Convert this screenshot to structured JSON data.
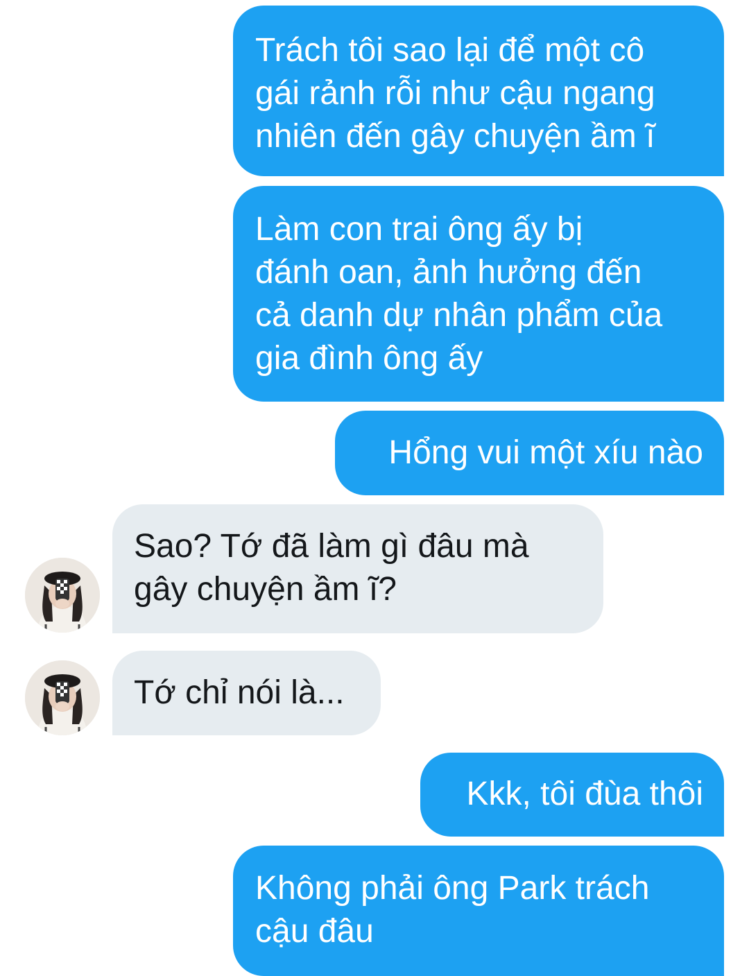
{
  "conversation": {
    "messages": [
      {
        "sender": "me",
        "text": "Trách tôi sao lại để một cô\ngái rảnh rỗi như cậu ngang\nnhiên đến gây chuyện ầm ĩ"
      },
      {
        "sender": "me",
        "text": "Làm con trai ông ấy bị\nđánh oan, ảnh hưởng đến\ncả danh dự nhân phẩm của\ngia đình ông ấy"
      },
      {
        "sender": "me",
        "text": "Hổng vui một xíu nào"
      },
      {
        "sender": "other",
        "text": "Sao? Tớ đã làm gì đâu mà\ngây chuyện ầm ĩ?"
      },
      {
        "sender": "other",
        "text": "Tớ chỉ nói là..."
      },
      {
        "sender": "me",
        "text": "Kkk, tôi đùa thôi"
      },
      {
        "sender": "me",
        "text": "Không phải ông Park trách\ncậu đâu"
      }
    ]
  },
  "colors": {
    "sent_bubble": "#1da1f2",
    "sent_text": "#ffffff",
    "received_bubble": "#e6ecf0",
    "received_text": "#14171a",
    "background": "#ffffff"
  },
  "icons": {
    "avatar": "user-avatar-photo"
  }
}
